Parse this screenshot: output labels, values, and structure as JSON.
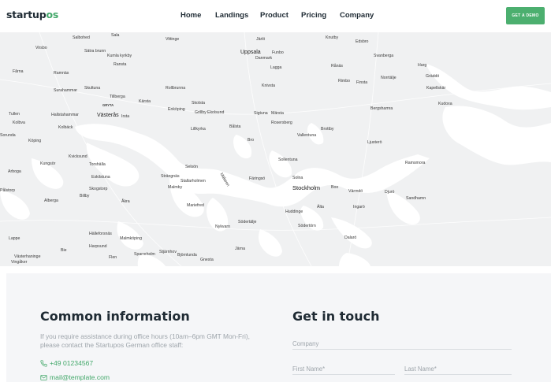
{
  "header": {
    "logo_main": "startup",
    "logo_accent": "os",
    "nav": [
      "Home",
      "Landings",
      "Product",
      "Pricing",
      "Company"
    ],
    "cta_label": "GET A DEMO"
  },
  "map": {
    "places": [
      "Sala",
      "Salbohed",
      "Vittinge",
      "Järlö",
      "Knutby",
      "Edsbro",
      "Virsbo",
      "Sätra brunn",
      "Uppsala",
      "Funbo",
      "Svanberga",
      "Kumla kyrkby",
      "Danmark",
      "Ransta",
      "Rånäs",
      "Harg",
      "Fărna",
      "Ramnäs",
      "Lagga",
      "Rimbo",
      "Finsta",
      "Norrtälje",
      "Gräddö",
      "Kapellskär",
      "Surahammar",
      "Skultuna",
      "Knivsta",
      "Rollbrunna",
      "Tillberga",
      "Kärsta",
      "Skolsta",
      "Kudoxa",
      "GRYTA",
      "Enköping",
      "Ekolsund",
      "Hallstahammar",
      "Västerås",
      "Irsta",
      "Sigtuna",
      "Märsta",
      "Bergshamra",
      "Kolbäck",
      "Lillkyrka",
      "Bålsta",
      "Rosersberg",
      "Brottby",
      "Vallentuna",
      "Köping",
      "Bro",
      "Ljusterö",
      "Kvicksund",
      "Torshälla",
      "Sollentuna",
      "Kungsör",
      "Eskilstuna",
      "Stallarholmen",
      "Strängnäs",
      "Selsön",
      "Färingsö",
      "Solna",
      "Ramsmora",
      "Arboga",
      "Mälaren",
      "Stockholm",
      "Boo",
      "Värmdö",
      "Djurö",
      "Sandhamn",
      "Skogstorp",
      "Malmby",
      "Mariefred",
      "Älta",
      "Ingarö",
      "Alberga",
      "Åkra",
      "Huddinge",
      "Södertälje",
      "Södertörn",
      "Nykvarn",
      "Dalarö",
      "Hälleforsnäs",
      "Malmköping",
      "Harpsund",
      "Järna",
      "Vingåker",
      "Flen",
      "Sparreholm",
      "Stjärnhov",
      "Björnlunda",
      "Gnesta",
      "Bie",
      "Lappe",
      "Tullen",
      "Kolbva",
      "Pålstorp",
      "Grillby",
      "Västerhaninge",
      "Billby",
      "Sorunda"
    ]
  },
  "info": {
    "title": "Common information",
    "description": "If you require assistance during office hours (10am–6pm GMT Mon-Fri), please contact the Startupos German office staff:",
    "phone": "+49 01234567",
    "email": "mail@template.com"
  },
  "form": {
    "title": "Get in touch",
    "company_placeholder": "Company",
    "first_name_placeholder": "First Name*",
    "last_name_placeholder": "Last Name*"
  },
  "colors": {
    "accent": "#43a86a",
    "cta_bg": "#4caf6f",
    "map_bg": "#f0f1f2",
    "water": "#ffffff",
    "info_bg": "#f5f6f8"
  }
}
